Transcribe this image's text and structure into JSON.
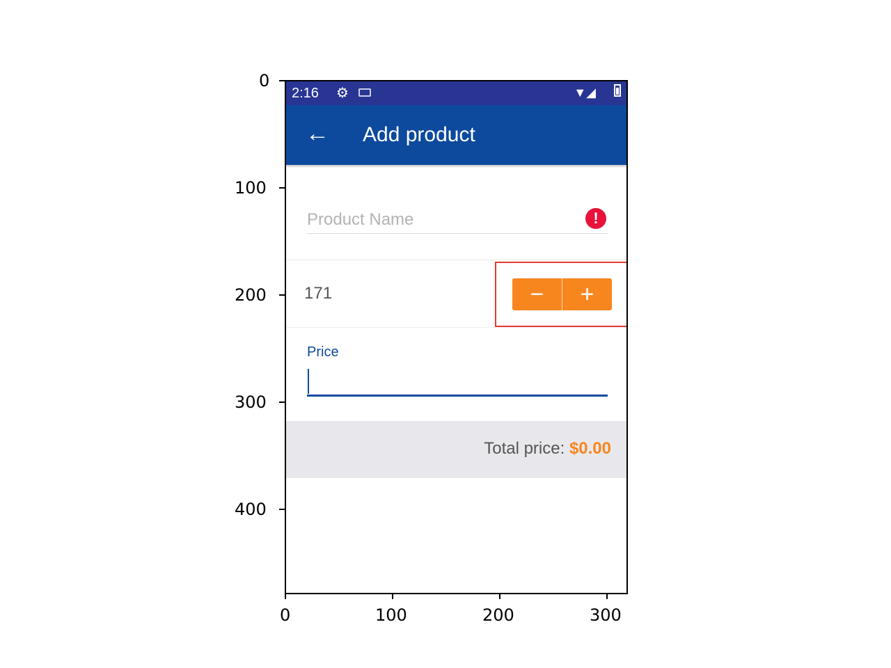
{
  "axes": {
    "y_ticks": [
      "0",
      "100",
      "200",
      "300",
      "400"
    ],
    "x_ticks": [
      "0",
      "100",
      "200",
      "300"
    ]
  },
  "status_bar": {
    "time": "2:16",
    "icons": [
      "gear-icon",
      "keyboard-icon",
      "wifi-icon",
      "signal-icon",
      "battery-icon"
    ],
    "color": "#283593"
  },
  "app_bar": {
    "title": "Add product",
    "back_icon": "arrow-left-icon",
    "color": "#0d4a9e"
  },
  "form": {
    "product_name": {
      "placeholder": "Product Name",
      "value": "",
      "error_icon": "error-icon"
    },
    "quantity": {
      "value": "171",
      "minus_label": "−",
      "plus_label": "+",
      "accent": "#f7861f"
    },
    "price": {
      "label": "Price",
      "value": ""
    }
  },
  "total": {
    "label": "Total price: ",
    "amount": "$0.00",
    "amount_color": "#f7861f"
  },
  "highlight": {
    "target": "quantity-stepper",
    "color": "#e53935"
  }
}
